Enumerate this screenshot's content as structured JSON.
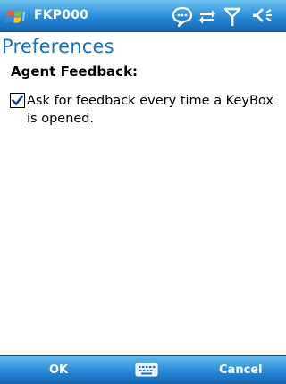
{
  "title_bar": {
    "app_title": "FKP000",
    "start_icon": "windows-flag-icon",
    "tray_icons": [
      "message-bubble-icon",
      "connectivity-arrows-icon",
      "signal-antenna-icon",
      "speaker-volume-icon"
    ]
  },
  "page": {
    "title": "Preferences",
    "section_label": "Agent Feedback:",
    "option": {
      "checked": true,
      "label": "Ask for feedback every time a KeyBox is opened."
    }
  },
  "menu_bar": {
    "left_softkey": "OK",
    "right_softkey": "Cancel",
    "input_icon": "keyboard-icon"
  },
  "colors": {
    "title_bar": "#1d7ccc",
    "page_title": "#1473c9",
    "menu_bar": "#1d7ccc"
  }
}
